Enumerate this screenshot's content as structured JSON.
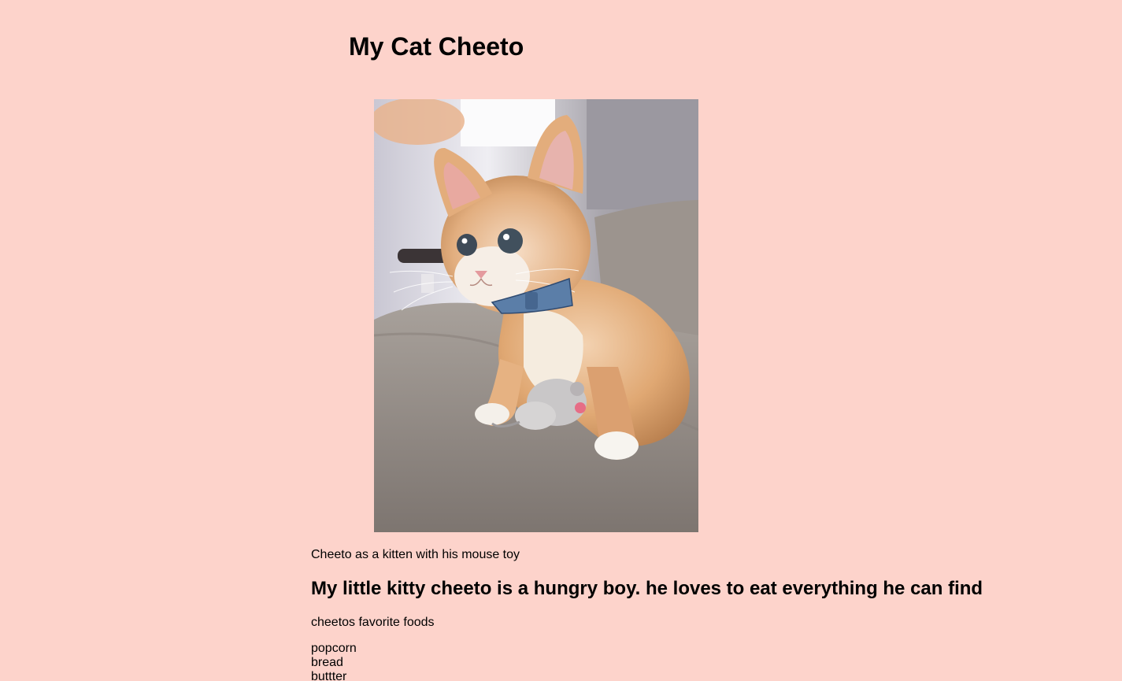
{
  "page": {
    "title": "My Cat Cheeto",
    "background_color": "#fdd3cb"
  },
  "photo": {
    "alt": "Orange and white kitten wearing a blue bow tie sitting on a gray couch with a small gray mouse toy"
  },
  "caption": "Cheeto as a kitten with his mouse toy",
  "subheading": "My little kitty cheeto is a hungry boy. he loves to eat everything he can find",
  "foods": {
    "label": "cheetos favorite foods",
    "items": [
      "popcorn",
      "bread",
      "buttter"
    ]
  }
}
